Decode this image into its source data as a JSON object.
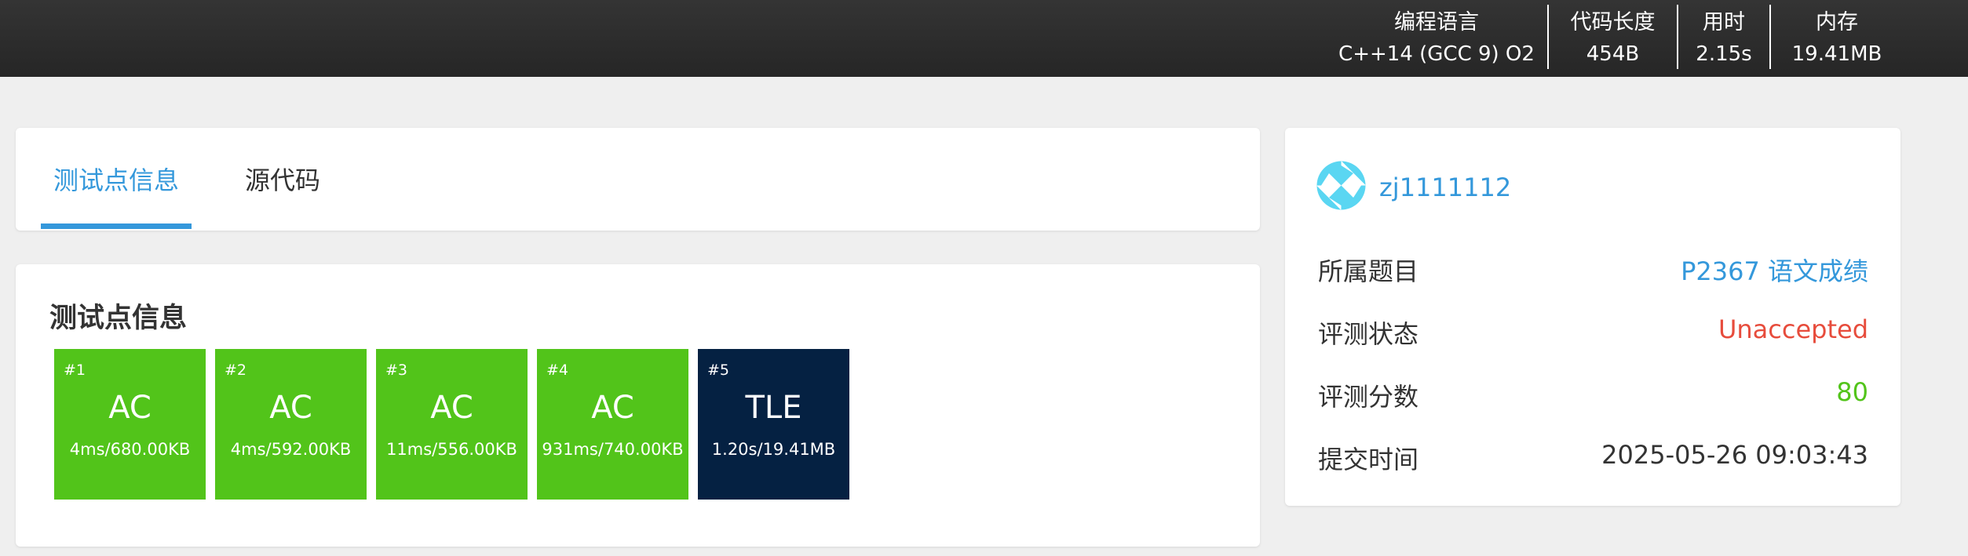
{
  "topbar": {
    "stats": [
      {
        "label": "编程语言",
        "value": "C++14 (GCC 9) O2"
      },
      {
        "label": "代码长度",
        "value": "454B"
      },
      {
        "label": "用时",
        "value": "2.15s"
      },
      {
        "label": "内存",
        "value": "19.41MB"
      }
    ]
  },
  "tabs": {
    "items": [
      {
        "label": "测试点信息",
        "active": true
      },
      {
        "label": "源代码",
        "active": false
      }
    ]
  },
  "testcases": {
    "title": "测试点信息",
    "items": [
      {
        "num": "#1",
        "status": "AC",
        "info": "4ms/680.00KB"
      },
      {
        "num": "#2",
        "status": "AC",
        "info": "4ms/592.00KB"
      },
      {
        "num": "#3",
        "status": "AC",
        "info": "11ms/556.00KB"
      },
      {
        "num": "#4",
        "status": "AC",
        "info": "931ms/740.00KB"
      },
      {
        "num": "#5",
        "status": "TLE",
        "info": "1.20s/19.41MB"
      }
    ]
  },
  "submission": {
    "user": "zj1111112",
    "rows": [
      {
        "label": "所属题目",
        "value": "P2367 语文成绩"
      },
      {
        "label": "评测状态",
        "value": "Unaccepted"
      },
      {
        "label": "评测分数",
        "value": "80"
      },
      {
        "label": "提交时间",
        "value": "2025-05-26 09:03:43"
      }
    ]
  },
  "colors": {
    "accent": "#3498db",
    "ac_green": "#52c41a",
    "tle_navy": "#052142",
    "unaccepted_red": "#e74c3c",
    "score_green": "#52c41a",
    "avatar": "#5ad6f2"
  },
  "icons": {
    "avatar": "avatar-pinwheel-icon"
  }
}
